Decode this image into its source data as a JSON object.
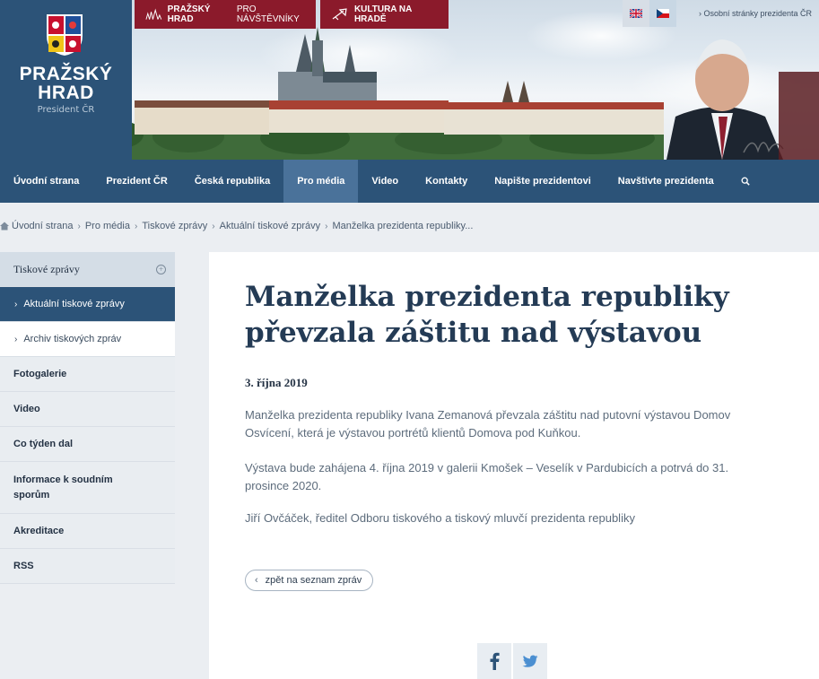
{
  "header": {
    "logo_name_line1": "PRAŽSKÝ",
    "logo_name_line2": "HRAD",
    "logo_sub": "President ČR",
    "btn_visitors_bold": "PRAŽSKÝ HRAD",
    "btn_visitors_rest": "PRO NÁVŠTĚVNÍKY",
    "btn_culture": "KULTURA NA HRADĚ",
    "personal_link": "› Osobní stránky prezidenta ČR",
    "lang_en_icon": "flag-uk-icon",
    "lang_cz_icon": "flag-cz-icon"
  },
  "nav": {
    "items": [
      {
        "label": "Úvodní strana"
      },
      {
        "label": "Prezident ČR"
      },
      {
        "label": "Česká republika"
      },
      {
        "label": "Pro média"
      },
      {
        "label": "Video"
      },
      {
        "label": "Kontakty"
      },
      {
        "label": "Napište prezidentovi"
      },
      {
        "label": "Navštivte prezidenta"
      }
    ],
    "active_index": 3,
    "search_icon": "search-icon"
  },
  "breadcrumb": {
    "items": [
      "Úvodní strana",
      "Pro média",
      "Tiskové zprávy",
      "Aktuální tiskové zprávy",
      "Manželka prezidenta republiky..."
    ]
  },
  "sidebar": {
    "head": "Tiskové zprávy",
    "sub_active": "Aktuální tiskové zprávy",
    "sub_archive": "Archiv tiskových zpráv",
    "items": [
      "Fotogalerie",
      "Video",
      "Co týden dal",
      "Informace k soudním sporům",
      "Akreditace",
      "RSS"
    ]
  },
  "article": {
    "title": "Manželka prezidenta republiky převzala záštitu nad výstavou",
    "date": "3. října 2019",
    "p1": "Manželka prezidenta republiky Ivana Zemanová převzala záštitu nad putovní výstavou Domov Osvícení, která je výstavou portrétů klientů Domova pod Kuňkou.",
    "p2": "Výstava bude zahájena 4. října 2019 v galerii Kmošek – Veselík v Pardubicích a potrvá do 31. prosince 2020.",
    "p3": "Jiří Ovčáček, ředitel Odboru tiskového a tiskový mluvčí prezidenta republiky",
    "back_label": "zpět na seznam zpráv"
  },
  "colors": {
    "primary": "#2c5378",
    "nav_active": "#4a729a",
    "accent_red": "#8b1a2b",
    "background": "#ebeef2"
  }
}
